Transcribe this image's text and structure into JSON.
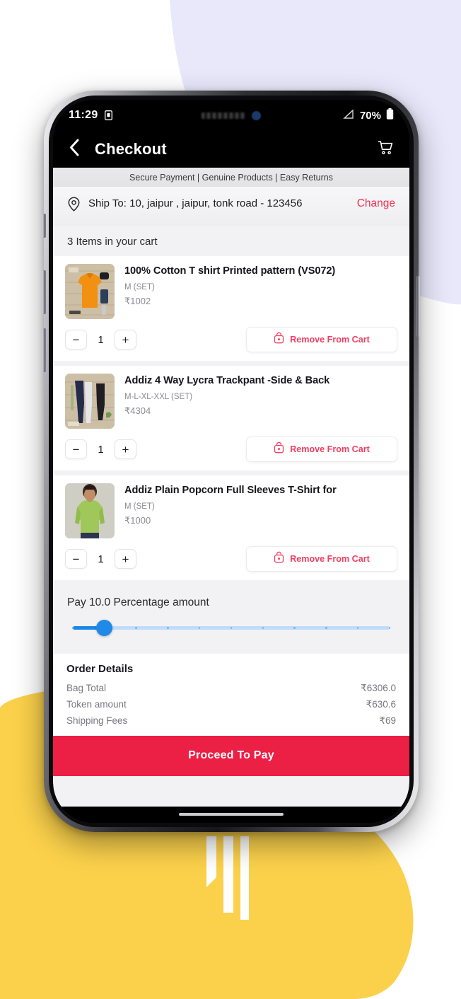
{
  "background": {
    "page_bg": "#ffffff",
    "lavender_blob": "#e6e6fa",
    "yellow_blob": "#fbd14b"
  },
  "device": {
    "frame_color": "#1a1a1d",
    "home_indicator": "home-indicator"
  },
  "status_bar": {
    "time": "11:29",
    "sim_icon": "sim-card-icon",
    "signal_icon": "no-signal-icon",
    "battery_percent": "70%",
    "battery_icon": "battery-icon"
  },
  "app_bar": {
    "back_icon": "back-chevron-icon",
    "title": "Checkout",
    "cart_icon": "shopping-cart-icon"
  },
  "trust_strip": {
    "text": "Secure Payment | Genuine Products | Easy Returns"
  },
  "shipping": {
    "pin_icon": "location-pin-icon",
    "address": "Ship To: 10, jaipur , jaipur, tonk road - 123456",
    "change_label": "Change",
    "change_color": "#ef3052"
  },
  "cart": {
    "count_text": "3 Items in your cart",
    "items": [
      {
        "name": "100% Cotton T shirt Printed pattern (VS072)",
        "variant": "M (SET)",
        "price": "₹1002",
        "quantity": "1",
        "decrement_label": "−",
        "increment_label": "+",
        "remove_label": "Remove From Cart",
        "thumb_icon": "product-thumbnail-orange-tshirt"
      },
      {
        "name": "Addiz 4 Way Lycra Trackpant -Side & Back",
        "variant": "M-L-XL-XXL (SET)",
        "price": "₹4304",
        "quantity": "1",
        "decrement_label": "−",
        "increment_label": "+",
        "remove_label": "Remove From Cart",
        "thumb_icon": "product-thumbnail-trackpants"
      },
      {
        "name": "Addiz Plain Popcorn Full Sleeves T-Shirt for",
        "variant": "M (SET)",
        "price": "₹1000",
        "quantity": "1",
        "decrement_label": "−",
        "increment_label": "+",
        "remove_label": "Remove From Cart",
        "thumb_icon": "product-thumbnail-green-tshirt"
      }
    ]
  },
  "pay_percentage": {
    "label": "Pay 10.0 Percentage amount",
    "value": 10,
    "min": 0,
    "max": 100,
    "step_ticks": 11,
    "track_color": "#bfdcf8",
    "fill_color": "#1f86e8",
    "thumb_color": "#2189e8"
  },
  "order_details": {
    "title": "Order Details",
    "rows": [
      {
        "label": "Bag Total",
        "value": "₹6306.0"
      },
      {
        "label": "Token amount",
        "value": "₹630.6"
      },
      {
        "label": "Shipping Fees",
        "value": "₹69"
      }
    ]
  },
  "pay_bar": {
    "label": "Proceed To Pay",
    "color": "#ec1f45"
  }
}
